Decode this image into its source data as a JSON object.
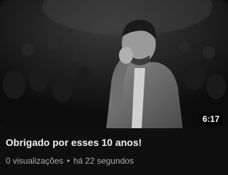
{
  "video": {
    "title": "Obrigado por esses 10 anos!",
    "duration": "6:17",
    "views": "0 visualizações",
    "separator": "•",
    "age": "há 22 segundos"
  }
}
